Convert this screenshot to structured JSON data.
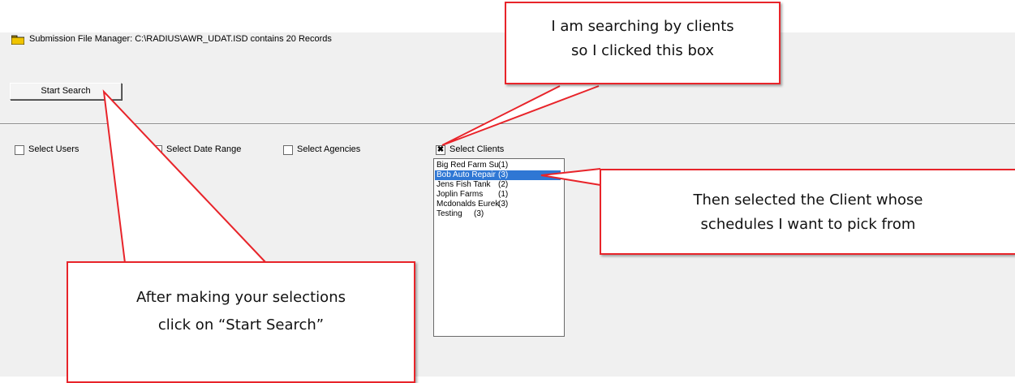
{
  "window": {
    "title": "Submission File Manager:  C:\\RADIUS\\AWR_UDAT.ISD contains 20 Records",
    "title_icon": "folder-icon"
  },
  "toolbar": {
    "start_search_label": "Start Search"
  },
  "filters": {
    "users": {
      "label": "Select Users",
      "checked": false
    },
    "date_range": {
      "label": "Select Date Range",
      "checked": false
    },
    "agencies": {
      "label": "Select Agencies",
      "checked": false
    },
    "clients": {
      "label": "Select Clients",
      "checked": true
    }
  },
  "clients_list": {
    "items": [
      {
        "name": "Big Red Farm Su",
        "count": "(1)",
        "selected": false
      },
      {
        "name": "Bob Auto Repair",
        "count": "(3)",
        "selected": true
      },
      {
        "name": "Jens Fish Tank",
        "count": "(2)",
        "selected": false
      },
      {
        "name": "Joplin Farms",
        "count": "(1)",
        "selected": false
      },
      {
        "name": "Mcdonalds Eurek",
        "count": "(3)",
        "selected": false
      },
      {
        "name": "Testing",
        "count": "(3)",
        "selected": false
      }
    ]
  },
  "callouts": {
    "clients_box": {
      "line1": "I am searching by clients",
      "line2": "so I clicked this box"
    },
    "selected_client": {
      "line1": "Then selected the Client whose",
      "line2": "schedules I want to pick from"
    },
    "start_search": {
      "line1": "After making your selections",
      "line2": "click on “Start Search”"
    }
  },
  "colors": {
    "callout_border": "#e8242a",
    "selection": "#2f77d4",
    "window_bg": "#f0f0f0"
  }
}
